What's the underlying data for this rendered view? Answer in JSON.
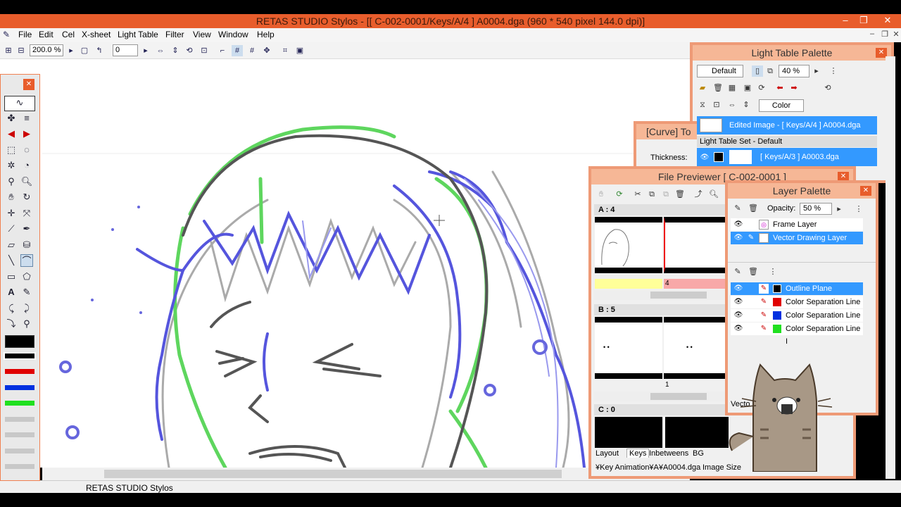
{
  "window": {
    "title": "RETAS STUDIO Stylos - [[ C-002-0001/Keys/A/4 ] A0004.dga (960 * 540 pixel 144.0 dpi)]",
    "min_label": "‒",
    "restore_label": "❐",
    "close_label": "✕"
  },
  "menu": {
    "items": [
      "File",
      "Edit",
      "Cel",
      "X-sheet",
      "Light Table",
      "Filter",
      "View",
      "Window",
      "Help"
    ]
  },
  "toolbar": {
    "zoom_value": "200.0 %",
    "rotation_value": "0"
  },
  "status": {
    "text": "RETAS STUDIO Stylos"
  },
  "colors": {
    "swatches": [
      "#000000",
      "#e00000",
      "#0030e0",
      "#20e020"
    ]
  },
  "light_table": {
    "title": "Light Table Palette",
    "preset": "Default",
    "opacity": "40 %",
    "mode": "Color",
    "edited_image": "Edited Image - [ Keys/A/4 ] A0004.dga",
    "set_label": "Light Table Set - Default",
    "layer_file": "[ Keys/A/3 ] A0003.dga"
  },
  "curve_tool": {
    "title": "[Curve] To",
    "thickness_label": "Thickness:"
  },
  "file_previewer": {
    "title": "File Previewer [ C-002-0001 ]",
    "sections": [
      {
        "label": "A : 4",
        "frame_number": "4"
      },
      {
        "label": "B : 5",
        "frame_number": "1"
      },
      {
        "label": "C : 0",
        "frame_number": ""
      }
    ],
    "tabs": [
      "Layout",
      "Keys",
      "Inbetweens",
      "BG"
    ],
    "path_text": "¥Key Animation¥A¥A0004.dga",
    "image_size_label": "Image Size"
  },
  "layer_palette": {
    "title": "Layer Palette",
    "opacity_label": "Opacity:",
    "opacity_value": "50 %",
    "layers": [
      {
        "name": "Frame Layer"
      },
      {
        "name": "Vector Drawing Layer"
      }
    ],
    "planes": [
      {
        "name": "Outline Plane",
        "color": "#000000"
      },
      {
        "name": "Color Separation Line I",
        "color": "#e00000"
      },
      {
        "name": "Color Separation Line I",
        "color": "#0030e0"
      },
      {
        "name": "Color Separation Line I",
        "color": "#20e020"
      }
    ],
    "footer": "Vecto"
  }
}
